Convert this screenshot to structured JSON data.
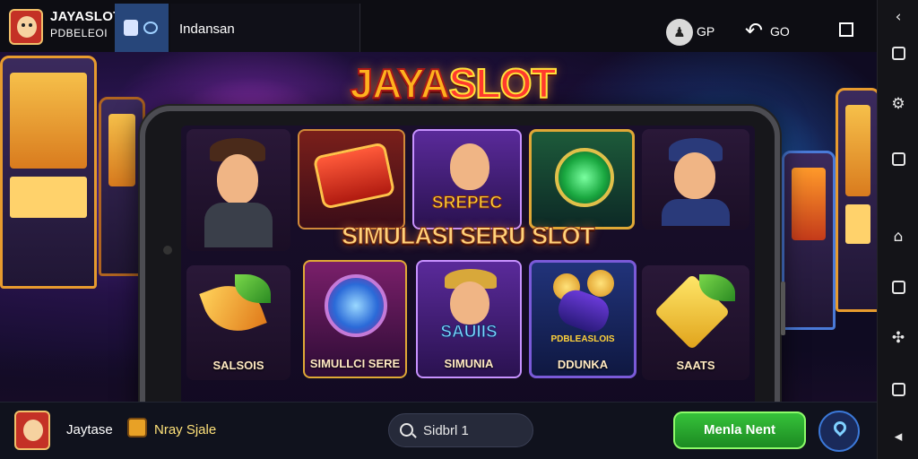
{
  "topbar": {
    "brand_line1": "JAYASLOT",
    "brand_line2": "PDBELEOI",
    "address_text": "Indansan",
    "item1_text": "GP",
    "item1_icon": "badge-icon",
    "item2_text": "GO",
    "item2_icon": "share-arrow-icon"
  },
  "hero": {
    "title_part1": "JAYA",
    "title_part2": "SLOT",
    "center_text": "SIMULASI SERU SLOT"
  },
  "tiles": {
    "t3_word": "SREPEC",
    "t7_label": "SALSOIS",
    "t8_label": "SIMULLCI SERE",
    "t9_word": "SAUIIS",
    "t9_label": "SIMUNIA",
    "t10_word": "PDBLEASLOIS",
    "t10_label": "DDUNKA",
    "t11_label": "SAATS"
  },
  "bottombar": {
    "brand1": "Jaytase",
    "brand2": "Nray Sjale",
    "search_text": "Sidbrl 1",
    "cta_label": "Menla Nent"
  },
  "sidebar": {
    "icons": [
      "chevron-left-icon",
      "rotate-icon",
      "settings-icon",
      "folder-icon",
      "home-icon",
      "puzzle-icon",
      "screenshot-icon",
      "back-icon"
    ]
  },
  "colors": {
    "accent_gold": "#ffb21e",
    "cta_green": "#36c23a",
    "topbtn_blue": "#27467a"
  }
}
